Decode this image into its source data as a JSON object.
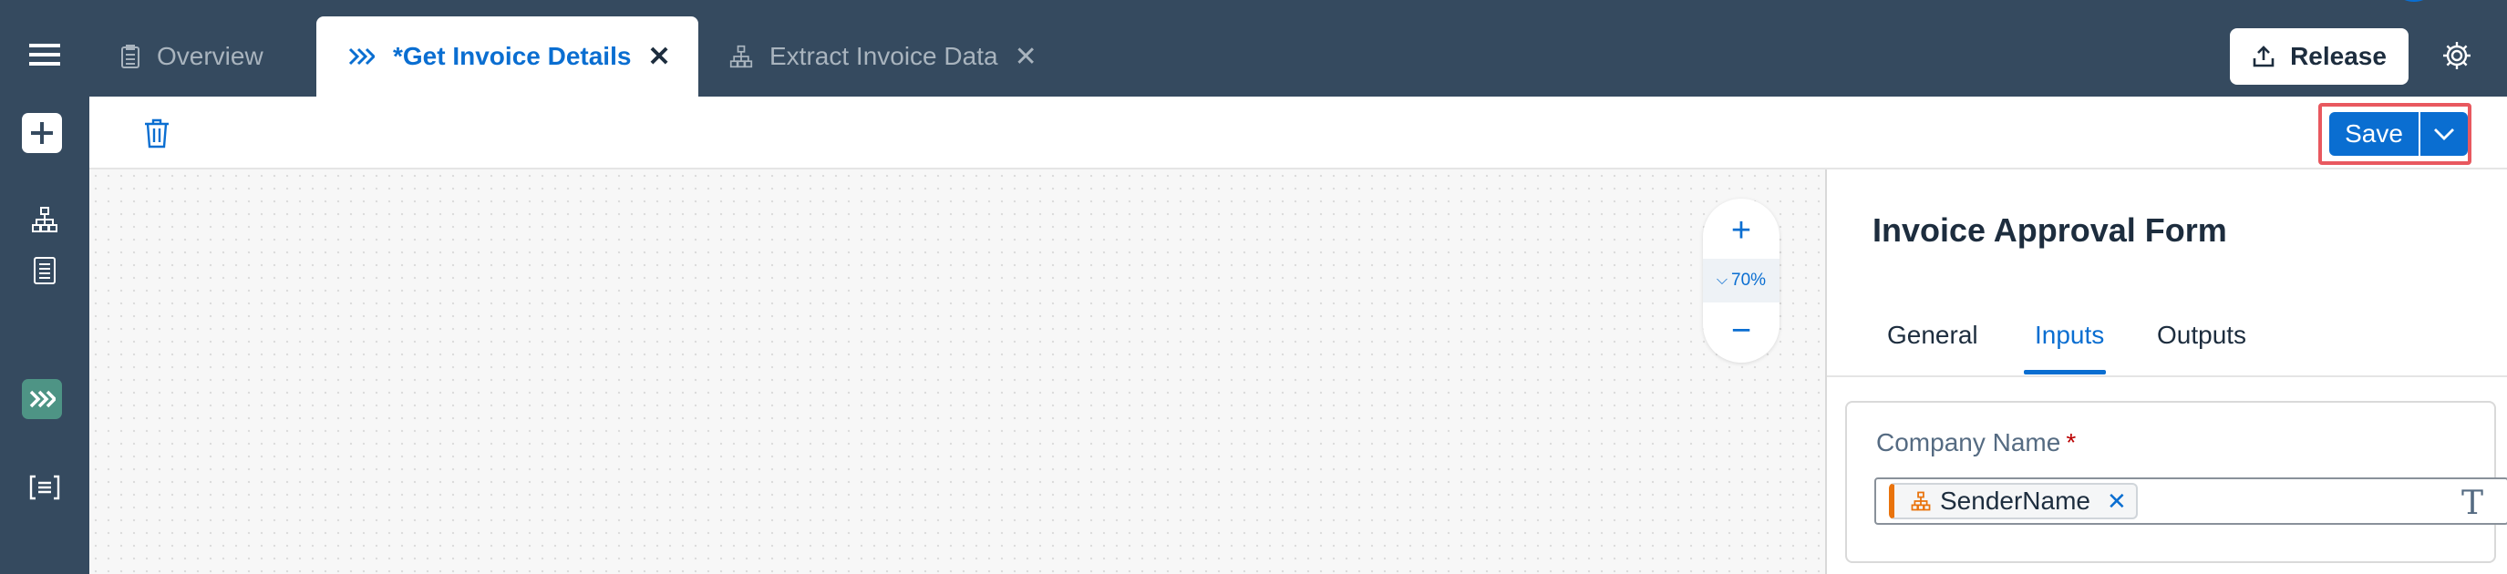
{
  "shell": {
    "tabs": [
      {
        "label": "Overview",
        "icon": "document-icon"
      },
      {
        "label": "*Get Invoice Details",
        "icon": "chevrons-right-icon",
        "active": true
      },
      {
        "label": "Extract Invoice Data",
        "icon": "hierarchy-icon"
      }
    ],
    "release_label": "Release"
  },
  "toolbar": {
    "save_label": "Save"
  },
  "canvas": {
    "zoom_level": "70%"
  },
  "panel": {
    "title": "Invoice Approval Form",
    "tabs": [
      "General",
      "Inputs",
      "Outputs"
    ],
    "active_tab": "Inputs",
    "field": {
      "label": "Company Name",
      "required_mark": "*",
      "token_value": "SenderName",
      "type_glyph": "T"
    }
  },
  "colors": {
    "shell_bg": "#354a5f",
    "accent": "#0a6ed1",
    "active_rail": "#4e9485",
    "highlight": "#e8585f",
    "token_accent": "#e9730c"
  }
}
